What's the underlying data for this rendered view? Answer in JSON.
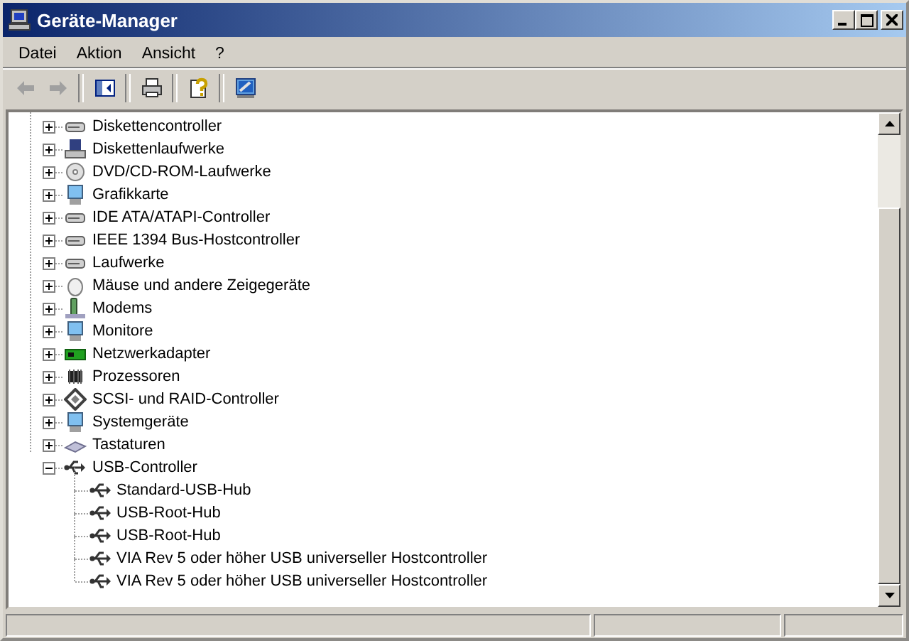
{
  "window": {
    "title": "Geräte-Manager"
  },
  "menu": [
    {
      "label": "Datei"
    },
    {
      "label": "Aktion"
    },
    {
      "label": "Ansicht"
    },
    {
      "label": "?"
    }
  ],
  "toolbar": [
    {
      "kind": "back",
      "disabled": true
    },
    {
      "kind": "forward",
      "disabled": true
    },
    {
      "kind": "separator"
    },
    {
      "kind": "tree"
    },
    {
      "kind": "separator"
    },
    {
      "kind": "print"
    },
    {
      "kind": "separator"
    },
    {
      "kind": "properties"
    },
    {
      "kind": "separator"
    },
    {
      "kind": "scan"
    }
  ],
  "tree": [
    {
      "label": "Diskettencontroller",
      "expanded": false,
      "kind": "controller"
    },
    {
      "label": "Diskettenlaufwerke",
      "expanded": false,
      "kind": "floppy"
    },
    {
      "label": "DVD/CD-ROM-Laufwerke",
      "expanded": false,
      "kind": "disc"
    },
    {
      "label": "Grafikkarte",
      "expanded": false,
      "kind": "monitor"
    },
    {
      "label": "IDE ATA/ATAPI-Controller",
      "expanded": false,
      "kind": "controller"
    },
    {
      "label": "IEEE 1394 Bus-Hostcontroller",
      "expanded": false,
      "kind": "drive"
    },
    {
      "label": "Laufwerke",
      "expanded": false,
      "kind": "drive"
    },
    {
      "label": "Mäuse und andere Zeigegeräte",
      "expanded": false,
      "kind": "mouse"
    },
    {
      "label": "Modems",
      "expanded": false,
      "kind": "modem"
    },
    {
      "label": "Monitore",
      "expanded": false,
      "kind": "monitor"
    },
    {
      "label": "Netzwerkadapter",
      "expanded": false,
      "kind": "card"
    },
    {
      "label": "Prozessoren",
      "expanded": false,
      "kind": "chip"
    },
    {
      "label": "SCSI- und RAID-Controller",
      "expanded": false,
      "kind": "scsi"
    },
    {
      "label": "Systemgeräte",
      "expanded": false,
      "kind": "monitor"
    },
    {
      "label": "Tastaturen",
      "expanded": false,
      "kind": "keyboard"
    },
    {
      "label": "USB-Controller",
      "expanded": true,
      "kind": "usb",
      "children": [
        {
          "label": "Standard-USB-Hub",
          "kind": "usb"
        },
        {
          "label": "USB-Root-Hub",
          "kind": "usb"
        },
        {
          "label": "USB-Root-Hub",
          "kind": "usb"
        },
        {
          "label": "VIA Rev 5 oder höher USB universeller Hostcontroller",
          "kind": "usb"
        },
        {
          "label": "VIA Rev 5 oder höher USB universeller Hostcontroller",
          "kind": "usb"
        }
      ]
    }
  ]
}
